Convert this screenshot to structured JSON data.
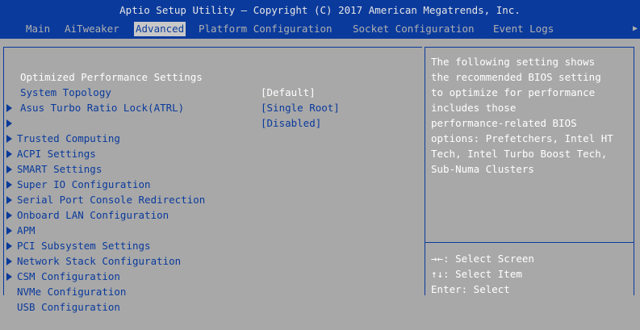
{
  "header": {
    "title": "Aptio Setup Utility – Copyright (C) 2017 American Megatrends, Inc.",
    "tabs": [
      "Main",
      "AiTweaker",
      "Advanced",
      "Platform Configuration",
      "Socket Configuration",
      "Event Logs"
    ],
    "active_tab": "Advanced"
  },
  "settings": [
    {
      "label": "Optimized Performance Settings",
      "value": "[Default]"
    },
    {
      "label": "System Topology",
      "value": "[Single Root]"
    },
    {
      "label": "Asus Turbo Ratio Lock(ATRL)",
      "value": "[Disabled]"
    }
  ],
  "submenus": [
    "Trusted Computing",
    "ACPI Settings",
    "SMART Settings",
    "Super IO Configuration",
    "Serial Port Console Redirection",
    "Onboard LAN Configuration",
    "APM",
    "PCI Subsystem Settings",
    "Network Stack Configuration",
    "CSM Configuration",
    "NVMe Configuration",
    "USB Configuration"
  ],
  "help": {
    "lines": [
      "The following setting shows",
      "the recommended BIOS setting",
      "to optimize for performance",
      "includes those",
      "performance-related BIOS",
      "options: Prefetchers, Intel HT",
      "Tech, Intel Turbo Boost Tech,",
      "Sub-Numa Clusters"
    ]
  },
  "keys": [
    "→←: Select Screen",
    "↑↓: Select Item",
    "Enter: Select"
  ],
  "colors": {
    "background": "#a8a8a8",
    "title_bar": "#0a3a9c",
    "text_blue": "#0a3a9c",
    "highlight": "#ffffff"
  }
}
